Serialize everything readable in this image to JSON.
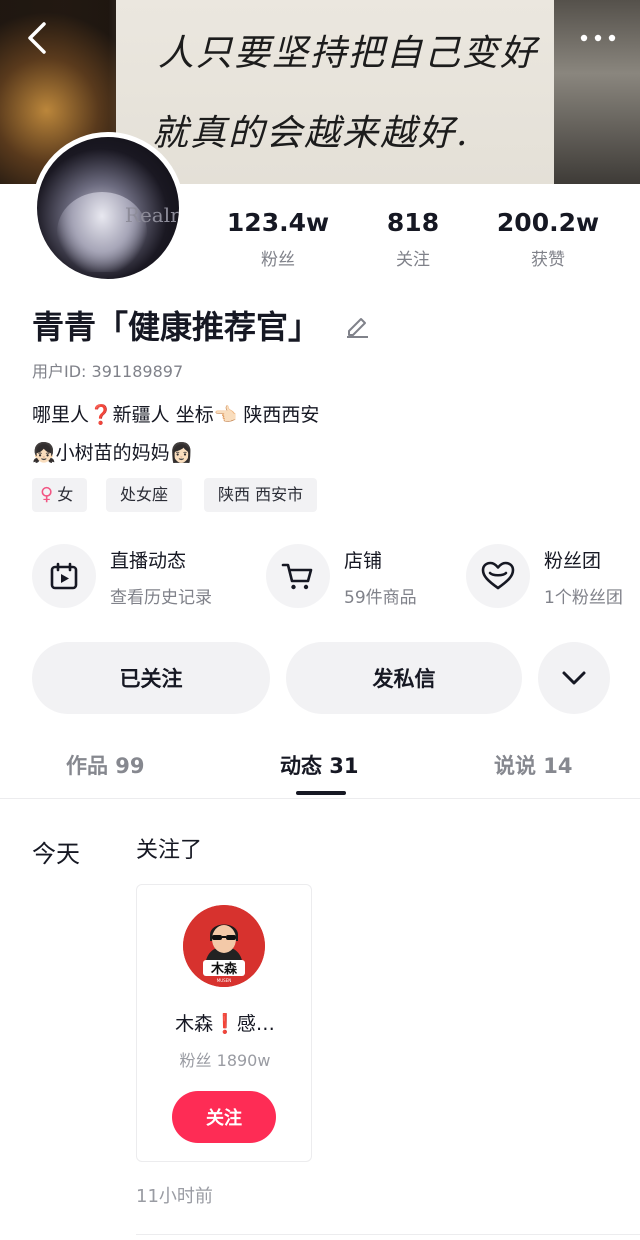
{
  "banner": {
    "line1": "人只要坚持把自己变好",
    "line2": "就真的会越来越好."
  },
  "avatar": {
    "overlay_text": "Realn"
  },
  "stats": [
    {
      "value": "123.4w",
      "label": "粉丝"
    },
    {
      "value": "818",
      "label": "关注"
    },
    {
      "value": "200.2w",
      "label": "获赞"
    }
  ],
  "profile": {
    "name": "青青「健康推荐官」",
    "user_id": "用户ID: 391189897",
    "bio_line1": "哪里人❓新疆人    坐标👈🏻 陕西西安",
    "bio_line2": "👧🏻小树苗的妈妈👩🏻"
  },
  "tags": [
    {
      "label": "女",
      "icon": "female-icon"
    },
    {
      "label": "处女座"
    },
    {
      "label": "陕西 西安市"
    }
  ],
  "features": [
    {
      "title": "直播动态",
      "subtitle": "查看历史记录",
      "icon": "live-calendar-icon"
    },
    {
      "title": "店铺",
      "subtitle": "59件商品",
      "icon": "shopping-cart-icon"
    },
    {
      "title": "粉丝团",
      "subtitle": "1个粉丝团",
      "icon": "heart-icon"
    }
  ],
  "actions": {
    "follow": "已关注",
    "message": "发私信"
  },
  "tabs": [
    {
      "label": "作品 99"
    },
    {
      "label": "动态 31"
    },
    {
      "label": "说说 14"
    }
  ],
  "feed": {
    "day": "今天",
    "action": "关注了",
    "card": {
      "avatar_text": "木森",
      "avatar_subtext": "MUSEN",
      "name": "木森❗感…",
      "fans": "粉丝 1890w",
      "button": "关注"
    },
    "time": "11小时前"
  },
  "colors": {
    "accent": "#fe2c55",
    "text": "#161823",
    "muted": "#80828a"
  }
}
